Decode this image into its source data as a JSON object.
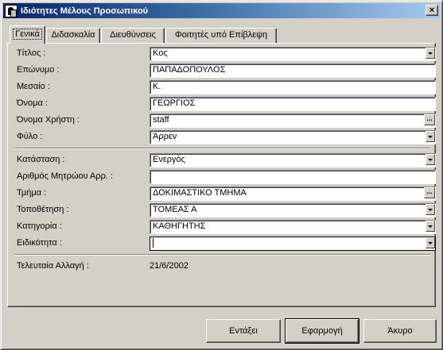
{
  "window": {
    "title": "Ιδιότητες Μέλους Προσωπικού",
    "close_glyph": "×"
  },
  "tabs": [
    {
      "label": "Γενικά",
      "active": true
    },
    {
      "label": "Διδασκαλία",
      "active": false
    },
    {
      "label": "Διευθύνσεις",
      "active": false
    },
    {
      "label": "Φοιτητές υπό Επίβλεψη",
      "active": false
    }
  ],
  "general": {
    "title_label": "Τίτλος :",
    "title_value": "Κος",
    "surname_label": "Επώνυμο :",
    "surname_value": "ΠΑΠΑΔΟΠΟΥΛΟΣ",
    "middle_label": "Μεσαίο :",
    "middle_value": "Κ.",
    "name_label": "Όνομα :",
    "name_value": "ΓΕΩΡΓΙΟΣ",
    "username_label": "Όνομα Χρήστη :",
    "username_value": "staff",
    "gender_label": "Φύλο :",
    "gender_value": "Άρρεν"
  },
  "employment": {
    "status_label": "Κατάσταση :",
    "status_value": "Ενεργός",
    "registry_label": "Αριθμός Μητρώου Αρρ. :",
    "registry_value": "",
    "department_label": "Τμήμα :",
    "department_value": "ΔΟΚΙΜΑΣΤΙΚΟ ΤΜΗΜΑ",
    "placement_label": "Τοποθέτηση :",
    "placement_value": "ΤΟΜΕΑΣ Α",
    "category_label": "Κατηγορία :",
    "category_value": "ΚΑΘΗΓΗΤΗΣ",
    "specialty_label": "Ειδικότητα :",
    "specialty_value": ""
  },
  "last_change": {
    "label": "Τελευταία Αλλαγή :",
    "value": "21/6/2002"
  },
  "buttons": {
    "ok": "Εντάξει",
    "apply": "Εφαρμογή",
    "cancel": "Άκυρο"
  },
  "icons": {
    "ellipsis": "...",
    "window_icon": "staff-properties-icon"
  }
}
